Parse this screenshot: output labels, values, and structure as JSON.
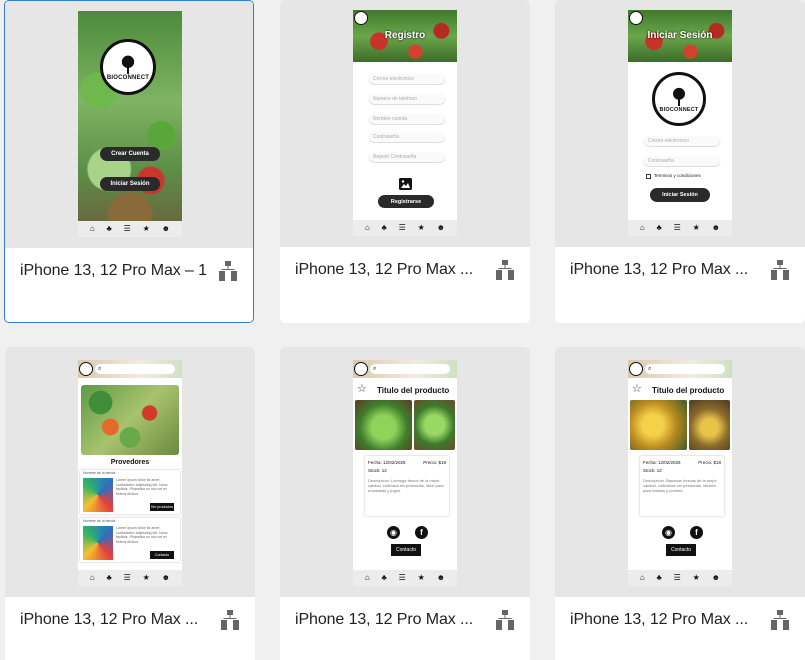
{
  "cards": [
    {
      "title": "iPhone 13, 12 Pro Max – 1",
      "selected": true
    },
    {
      "title": "iPhone 13, 12 Pro Max ..."
    },
    {
      "title": "iPhone 13, 12 Pro Max ..."
    },
    {
      "title": "iPhone 13, 12 Pro Max ..."
    },
    {
      "title": "iPhone 13, 12 Pro Max ..."
    },
    {
      "title": "iPhone 13, 12 Pro Max ..."
    }
  ],
  "tabbar_icons": [
    "home-icon",
    "tree-icon",
    "list-icon",
    "star-icon",
    "user-icon"
  ],
  "tabbar_glyphs": [
    "⌂",
    "♣",
    "☰",
    "★",
    "☻"
  ],
  "splash": {
    "brand": "BIOCONNECT",
    "create": "Crear Cuenta",
    "login": "Iniciar Sesión"
  },
  "register": {
    "title": "Registro",
    "fields": [
      "Correo electronico",
      "Numero de telefono",
      "Nombre cuenta",
      "Contraseña",
      "Repetir Contraseña"
    ],
    "button": "Registrarse"
  },
  "login": {
    "title": "Iniciar Sesión",
    "brand": "BIOCONNECT",
    "fields": [
      "Correo electronico",
      "Contraseña"
    ],
    "terms": "Terminos y condiciones",
    "button": "Iniciar Sesión"
  },
  "providers": {
    "title": "Provedores",
    "card_head": "Nombre de la tienda",
    "card_text": "Lorem ipsum dolor sit amet, consectetur adipiscing elit. Nunc facilisis. Phasellus eu nisi vel ex finibus dictum.",
    "btn1": "Ver productos",
    "btn2": "Contacto"
  },
  "product1": {
    "title": "Titulo del producto",
    "fecha": "Fecha:  12/02/2025",
    "precio": "Precio: $18",
    "stock": "Stock:  12",
    "desc": "Descripcion: Lechuga fresca de la mejor calidad, cultivada sin pesticidas, ideal para ensaladas y jugos.",
    "contact": "Contacto"
  },
  "product2": {
    "title": "Titulo del producto",
    "fecha": "Fecha:  12/02/2025",
    "precio": "Precio: $18",
    "stock": "Stock:  12",
    "desc": "Descripcion: Bananas frescas de la mejor calidad, cultivadas sin pesticidas, ideales para batidos y postres.",
    "contact": "Contacto"
  },
  "colors": {
    "selected_border": "#2f80d1",
    "button_dark": "#2a2a2a"
  }
}
